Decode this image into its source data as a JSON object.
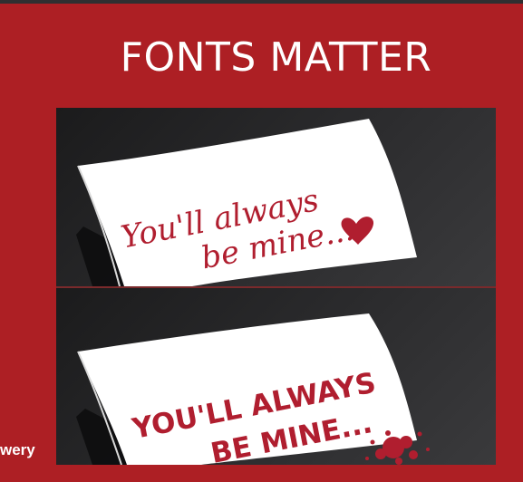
{
  "slide": {
    "title": "FONTS MATTER",
    "footer_fragment": "wery"
  },
  "notes": {
    "script_text_line1": "You'll always",
    "script_text_line2": "be mine...",
    "grunge_text_line1": "YOU'LL ALWAYS",
    "grunge_text_line2": "BE MINE..."
  },
  "colors": {
    "background": "#ad1f24",
    "ink": "#b01e2f"
  }
}
